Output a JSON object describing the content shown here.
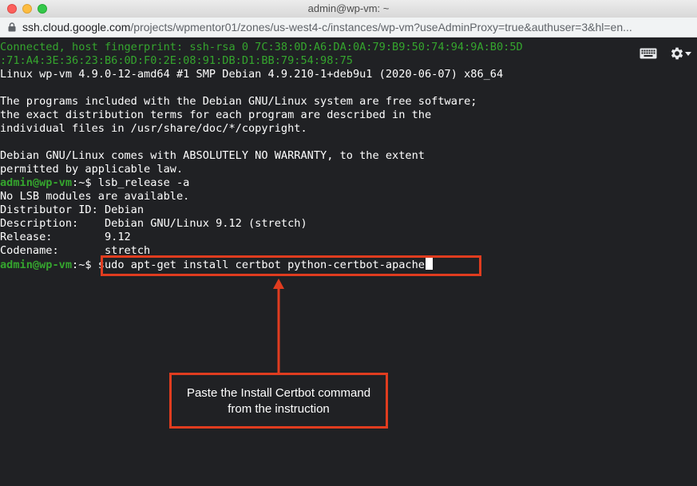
{
  "window": {
    "title": "admin@wp-vm: ~"
  },
  "urlbar": {
    "host": "ssh.cloud.google.com",
    "path": "/projects/wpmentor01/zones/us-west4-c/instances/wp-vm?useAdminProxy=true&authuser=3&hl=en..."
  },
  "terminal": {
    "connected_1": "Connected, host fingerprint: ssh-rsa 0 7C:38:0D:A6:DA:0A:79:B9:50:74:94:9A:B0:5D",
    "connected_2": ":71:A4:3E:36:23:B6:0D:F0:2E:08:91:DB:D1:BB:79:54:98:75",
    "uname": "Linux wp-vm 4.9.0-12-amd64 #1 SMP Debian 4.9.210-1+deb9u1 (2020-06-07) x86_64",
    "motd_1": "The programs included with the Debian GNU/Linux system are free software;",
    "motd_2": "the exact distribution terms for each program are described in the",
    "motd_3": "individual files in /usr/share/doc/*/copyright.",
    "motd_4": "Debian GNU/Linux comes with ABSOLUTELY NO WARRANTY, to the extent",
    "motd_5": "permitted by applicable law.",
    "prompt_user": "admin@wp-vm",
    "prompt_suffix": ":~$ ",
    "cmd_lsb": "lsb_release -a",
    "lsb_out_1": "No LSB modules are available.",
    "lsb_out_2": "Distributor ID: Debian",
    "lsb_out_3": "Description:    Debian GNU/Linux 9.12 (stretch)",
    "lsb_out_4": "Release:        9.12",
    "lsb_out_5": "Codename:       stretch",
    "cmd_certbot": "sudo apt-get install certbot python-certbot-apache"
  },
  "annotation": {
    "callout_line_1": "Paste the Install Certbot command",
    "callout_line_2": "from the instruction",
    "accent_color": "#e03c1f"
  },
  "icons": {
    "keyboard": "keyboard-icon",
    "settings": "gear-icon",
    "dropdown": "caret-down-icon"
  }
}
